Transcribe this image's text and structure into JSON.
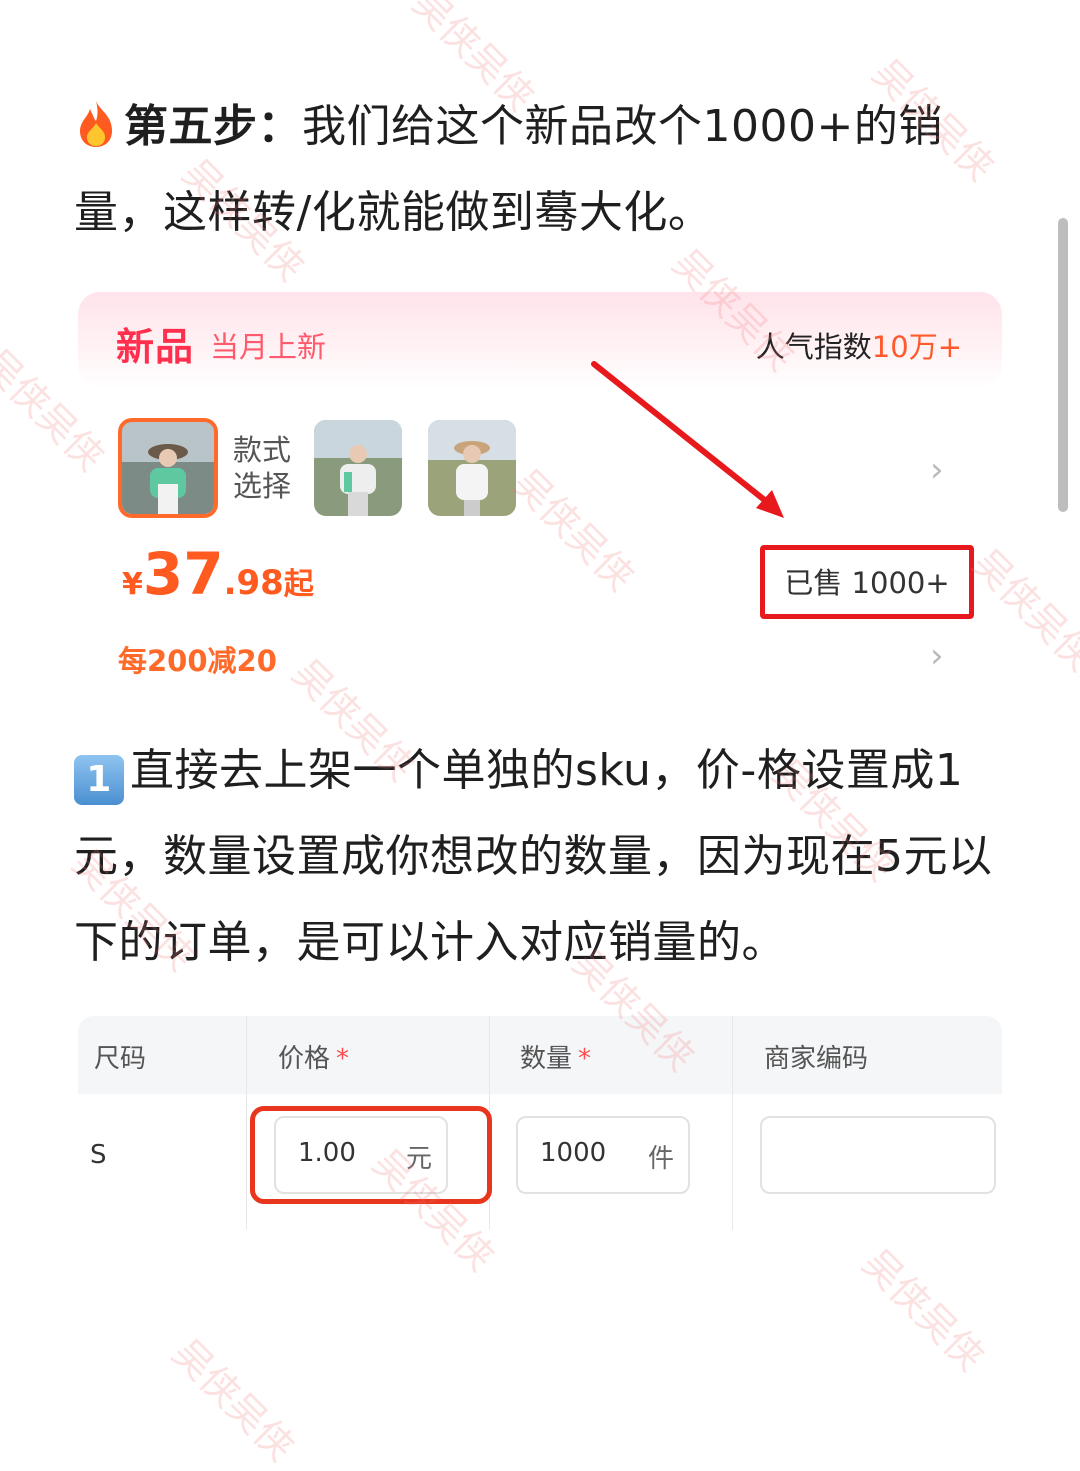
{
  "step_title": {
    "prefix": "第五步：",
    "text": "我们给这个新品改个1000+的销量，这样转/化就能做到蓦大化。"
  },
  "card": {
    "badge": "新品",
    "sub": "当月上新",
    "popularity_label": "人气指数",
    "popularity_value": "10万+",
    "style_label": "款式选择",
    "price_symbol": "¥",
    "price_int": "37",
    "price_dec": ".98",
    "price_suffix": "起",
    "sold": "已售 1000+",
    "promo": "每200减20"
  },
  "step1": {
    "badge": "1",
    "text": "直接去上架一个单独的sku，价-格设置成1元，数量设置成你想改的数量，因为现在5元以下的订单，是可以计入对应销量的。"
  },
  "sku_table": {
    "headers": [
      "尺码",
      "价格",
      "数量",
      "商家编码"
    ],
    "required_mark": "*",
    "row": {
      "size": "S",
      "price": "1.00",
      "price_unit": "元",
      "qty": "1000",
      "qty_unit": "件",
      "code": ""
    }
  },
  "watermark": "吴侠吴侠",
  "colors": {
    "accent_red": "#e8191d",
    "price_orange": "#ff5a1f",
    "new_red": "#ff2f4d"
  }
}
